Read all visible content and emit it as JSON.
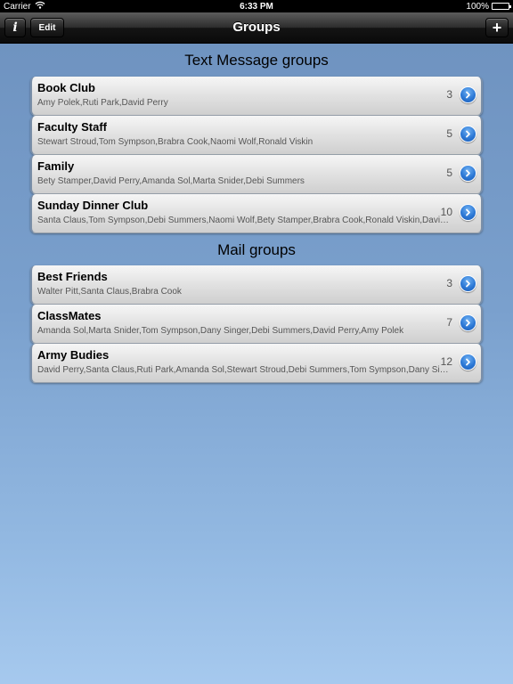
{
  "status_bar": {
    "carrier": "Carrier",
    "time": "6:33 PM",
    "battery": "100%",
    "battery_level": 1.0
  },
  "nav": {
    "title": "Groups",
    "info_label": "i",
    "edit_label": "Edit",
    "add_label": "+"
  },
  "text_groups": {
    "header": "Text Message groups",
    "items": [
      {
        "name": "Book Club",
        "members": "Amy Polek,Ruti Park,David Perry",
        "count": "3"
      },
      {
        "name": "Faculty Staff",
        "members": "Stewart Stroud,Tom Sympson,Brabra Cook,Naomi Wolf,Ronald Viskin",
        "count": "5"
      },
      {
        "name": "Family",
        "members": "Bety Stamper,David Perry,Amanda Sol,Marta Snider,Debi Summers",
        "count": "5"
      },
      {
        "name": "Sunday Dinner Club",
        "members": "Santa Claus,Tom Sympson,Debi Summers,Naomi Wolf,Bety Stamper,Brabra Cook,Ronald Viskin,David Perry,Amy Polek,Ruti Park",
        "count": "10"
      }
    ]
  },
  "mail_groups": {
    "header": "Mail groups",
    "items": [
      {
        "name": "Best Friends",
        "members": "Walter Pitt,Santa Claus,Brabra Cook",
        "count": "3"
      },
      {
        "name": "ClassMates",
        "members": "Amanda Sol,Marta Snider,Tom Sympson,Dany Singer,Debi Summers,David Perry,Amy Polek",
        "count": "7"
      },
      {
        "name": "Army Budies",
        "members": "David Perry,Santa Claus,Ruti Park,Amanda Sol,Stewart Stroud,Debi Summers,Tom Sympson,Dany Singer,Naomi Wolf,Walter Pitt,Bety Stamper,Marta Snider",
        "count": "12"
      }
    ]
  },
  "colors": {
    "accent": "#2d79d6",
    "background_top": "#6d91be",
    "background_bottom": "#a6c9ee"
  },
  "icons": {
    "wifi": "wifi-icon",
    "battery": "battery-icon",
    "info": "info-icon",
    "add": "plus-icon",
    "disclosure": "chevron-right-icon"
  }
}
